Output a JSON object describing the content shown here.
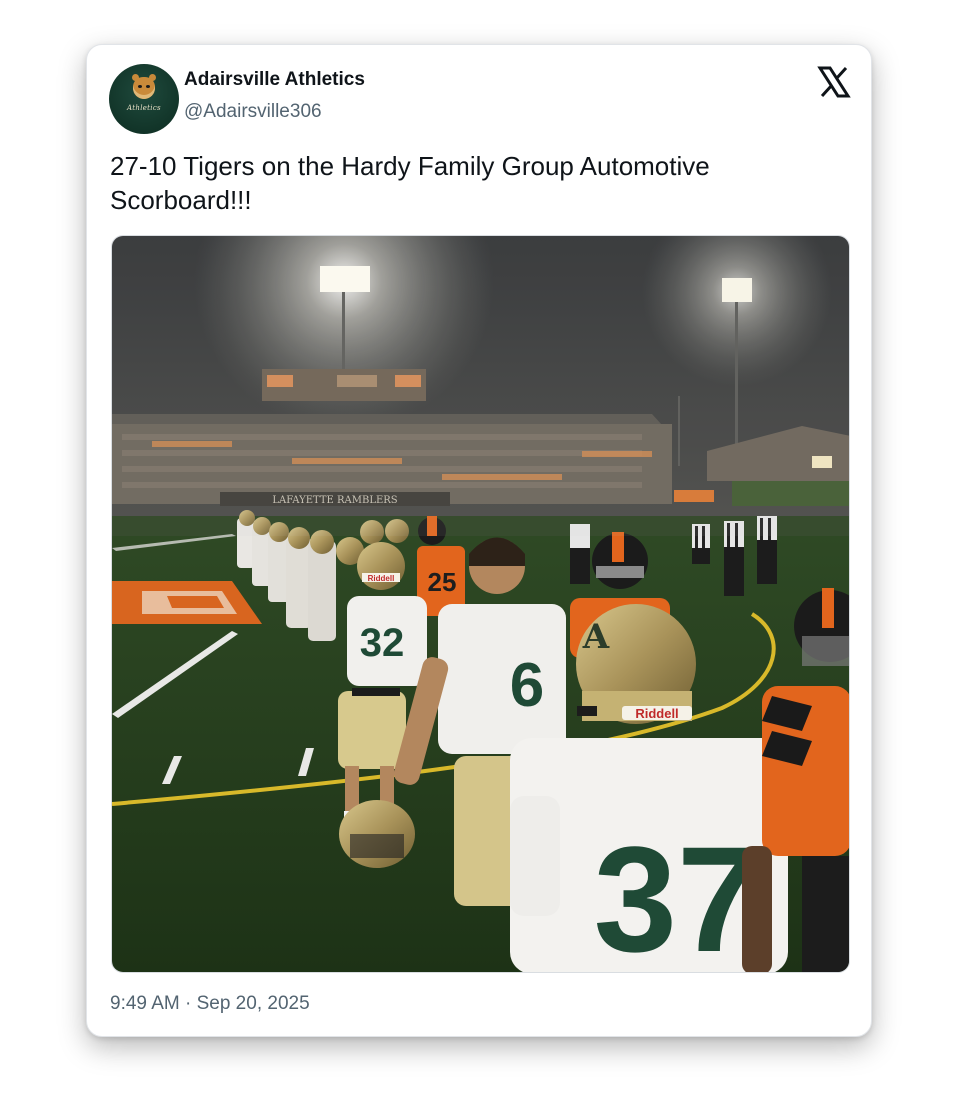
{
  "account": {
    "display_name": "Adairsville Athletics",
    "handle": "@Adairsville306",
    "avatar_text": "Athletics"
  },
  "tweet": {
    "text_line1": "27-10 Tigers on the Hardy Family Group Automotive",
    "text_line2": "Scorboard!!!",
    "timestamp": "9:49 AM · Sep 20, 2025"
  },
  "photo": {
    "banner_text": "LAFAYETTE RAMBLERS",
    "jersey_numbers": [
      "32",
      "6",
      "37",
      "25"
    ],
    "helmet_brand": "Riddell",
    "helmet_letter": "A"
  },
  "icons": {
    "platform_logo": "x-logo-icon"
  },
  "colors": {
    "brand_green": "#123529",
    "text_primary": "#0f1419",
    "text_secondary": "#536471",
    "home_orange": "#e8681e"
  }
}
